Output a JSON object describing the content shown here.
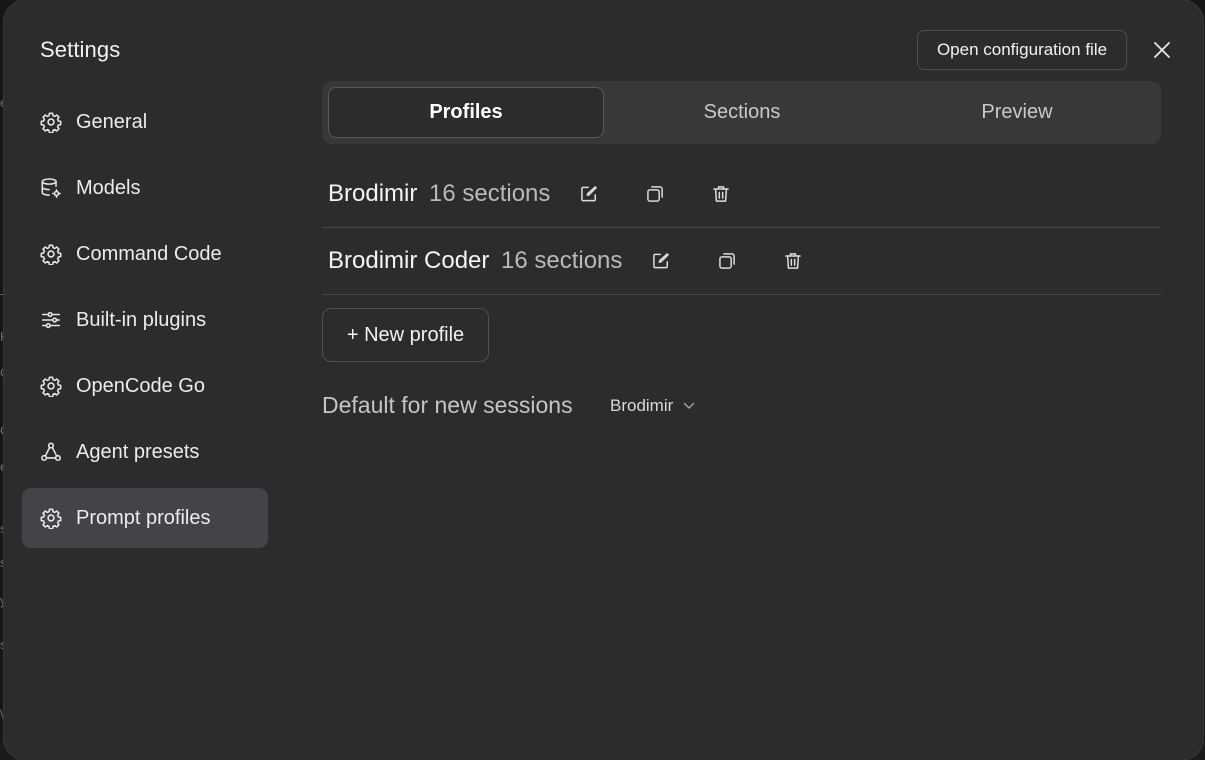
{
  "dialog": {
    "title": "Settings",
    "open_config_label": "Open configuration file",
    "close_icon": "close-icon"
  },
  "sidebar": {
    "items": [
      {
        "label": "General",
        "icon": "gear-icon"
      },
      {
        "label": "Models",
        "icon": "database-gear-icon"
      },
      {
        "label": "Command Code",
        "icon": "gear-icon"
      },
      {
        "label": "Built-in plugins",
        "icon": "sliders-icon"
      },
      {
        "label": "OpenCode Go",
        "icon": "gear-icon"
      },
      {
        "label": "Agent presets",
        "icon": "agents-icon"
      },
      {
        "label": "Prompt profiles",
        "icon": "gear-icon",
        "active": true
      }
    ]
  },
  "tabs": [
    {
      "label": "Profiles",
      "active": true
    },
    {
      "label": "Sections",
      "active": false
    },
    {
      "label": "Preview",
      "active": false
    }
  ],
  "profiles": [
    {
      "name": "Brodimir",
      "count": "16 sections"
    },
    {
      "name": "Brodimir Coder",
      "count": "16 sections"
    }
  ],
  "new_profile_label": "+ New profile",
  "default_section": {
    "label": "Default for new sessions",
    "selected": "Brodimir"
  },
  "colors": {
    "dialog_bg": "#2c2c2e",
    "active_item_bg": "#444448",
    "tabbar_bg": "#38383b"
  }
}
